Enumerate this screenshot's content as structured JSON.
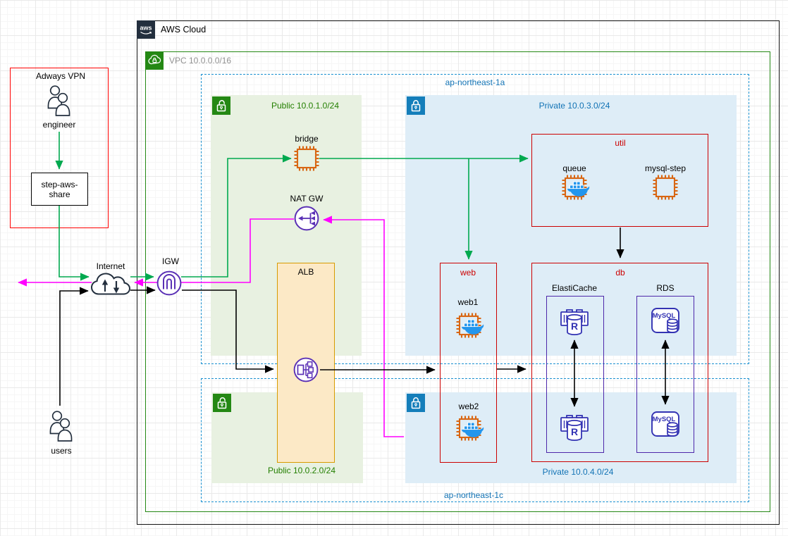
{
  "header": {
    "logo_text": "aws",
    "title": "AWS Cloud"
  },
  "vpc": {
    "label": "VPC 10.0.0.0/16"
  },
  "azs": {
    "a": {
      "label": "ap-northeast-1a"
    },
    "c": {
      "label": "ap-northeast-1c"
    }
  },
  "subnets": {
    "public1": {
      "label": "Public 10.0.1.0/24"
    },
    "private3": {
      "label": "Private 10.0.3.0/24"
    },
    "public2": {
      "label": "Public 10.0.2.0/24"
    },
    "private4": {
      "label": "Private 10.0.4.0/24"
    }
  },
  "vpn": {
    "title": "Adways VPN",
    "engineer_label": "engineer",
    "step_box_label": "step-aws-share"
  },
  "external": {
    "users_label": "users",
    "internet_label": "Internet"
  },
  "gateways": {
    "igw_label": "IGW",
    "nat_label": "NAT GW",
    "alb_label": "ALB"
  },
  "groups": {
    "web": "web",
    "util": "util",
    "db": "db"
  },
  "nodes": {
    "bridge": "bridge",
    "web1": "web1",
    "web2": "web2",
    "queue": "queue",
    "mysql_step": "mysql-step",
    "elasticache": "ElastiCache",
    "rds": "RDS",
    "mysql_icon_label": "MySQL",
    "redis_icon_letter": "R"
  },
  "colors": {
    "green_flow": "#00A94F",
    "magenta_flow": "#FF00FF",
    "black_flow": "#000000",
    "vpc_green": "#248814",
    "subnet_blue": "#147EBA",
    "az_dashed_blue": "#1990D0",
    "label_blue": "#1273B5",
    "label_green": "#237F00",
    "group_red": "#CC0000",
    "vpn_red": "#FF0000",
    "ec2_orange": "#D86613",
    "network_purple": "#5A30B5",
    "db_indigo": "#3333B3",
    "docker_blue": "#2396ED",
    "alb_fill": "#FCE9C6",
    "alb_border": "#D79B00",
    "public_fill": "#E8F1E1",
    "private_fill": "#DEEDF7",
    "aws_dark": "#232F3E"
  }
}
